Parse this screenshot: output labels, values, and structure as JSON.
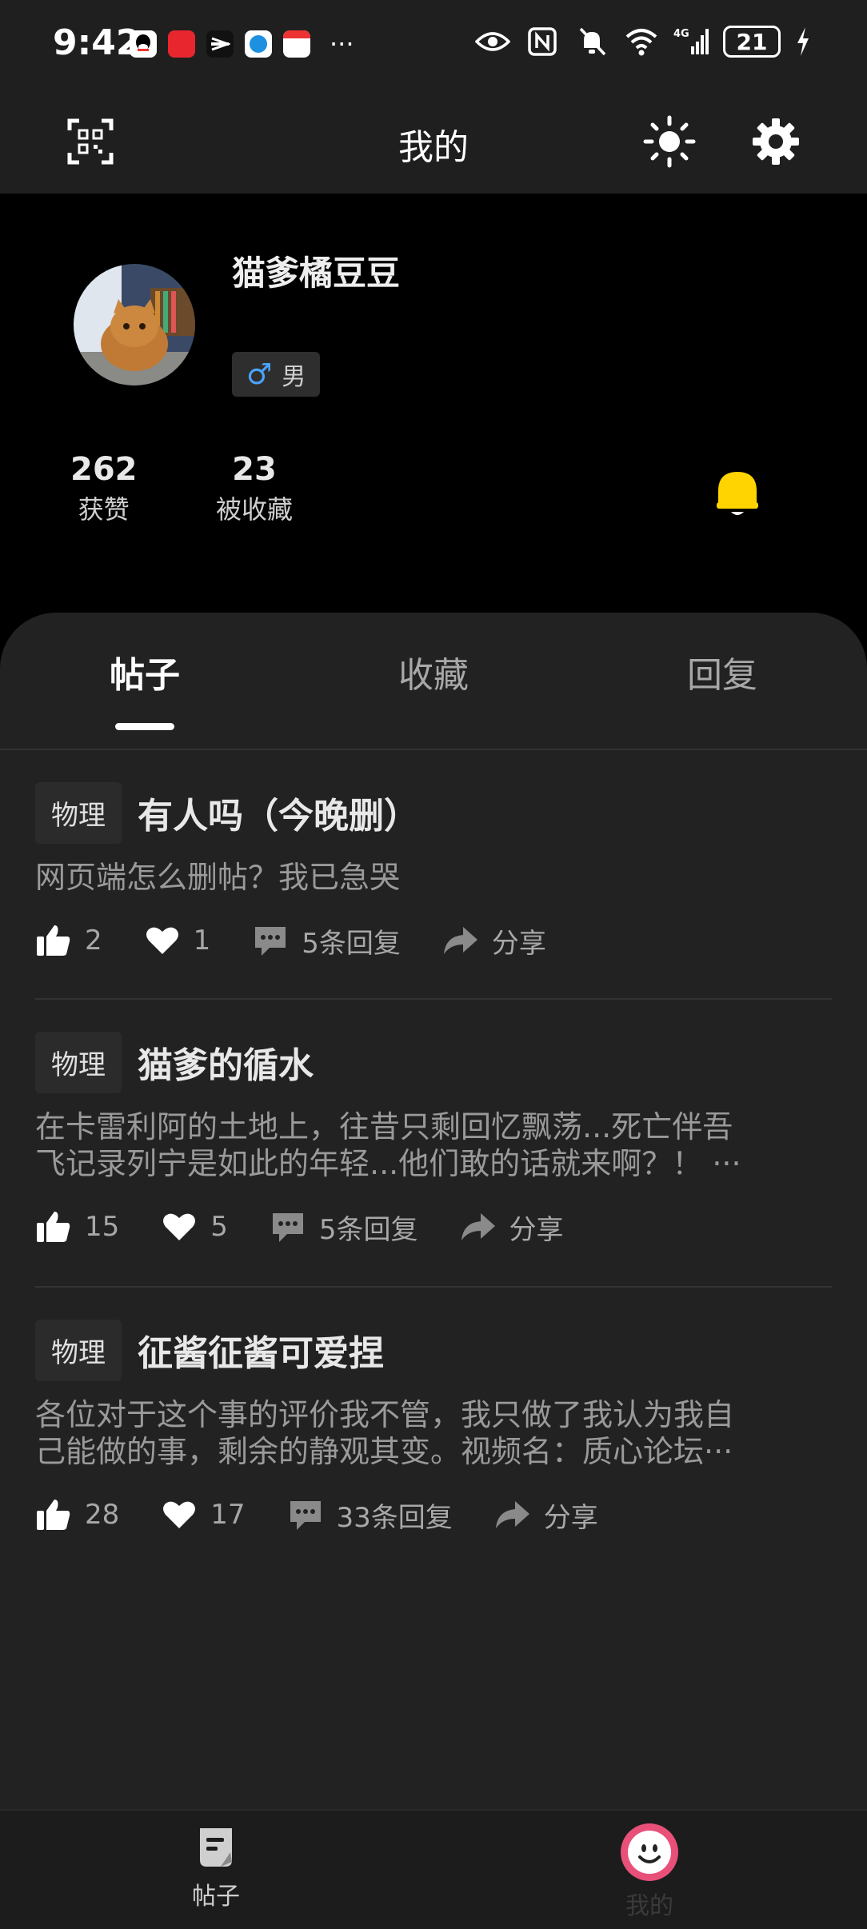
{
  "status_bar": {
    "time": "9:42",
    "more": "···",
    "battery": "21"
  },
  "header": {
    "title": "我的"
  },
  "profile": {
    "username": "猫爹橘豆豆",
    "gender_symbol": "♂",
    "gender": "男",
    "stats": [
      {
        "value": "262",
        "label": "获赞"
      },
      {
        "value": "23",
        "label": "被收藏"
      }
    ]
  },
  "tabs": [
    {
      "label": "帖子",
      "active": true
    },
    {
      "label": "收藏",
      "active": false
    },
    {
      "label": "回复",
      "active": false
    }
  ],
  "posts": [
    {
      "tag": "物理",
      "title": "有人吗（今晚删）",
      "body": "网页端怎么删帖？我已急哭",
      "likes": "2",
      "favorites": "1",
      "replies": "5条回复",
      "share": "分享"
    },
    {
      "tag": "物理",
      "title": "猫爹的循水",
      "body": "在卡雷利阿的土地上，往昔只剩回忆飘荡...死亡伴吾\n飞记录列宁是如此的年轻...他们敢的话就来啊？！ ···",
      "likes": "15",
      "favorites": "5",
      "replies": "5条回复",
      "share": "分享"
    },
    {
      "tag": "物理",
      "title": "征酱征酱可爱捏",
      "body": "各位对于这个事的评价我不管，我只做了我认为我自\n己能做的事，剩余的静观其变。视频名：质心论坛···",
      "likes": "28",
      "favorites": "17",
      "replies": "33条回复",
      "share": "分享"
    }
  ],
  "bottom_nav": [
    {
      "label": "帖子",
      "icon": "post-icon"
    },
    {
      "label": "我的",
      "icon": "smiley-avatar-icon"
    }
  ],
  "colors": {
    "accent_bell": "#ffd400",
    "nav_active_ring": "#e8507a",
    "tag_bg": "#2b2b2b"
  }
}
